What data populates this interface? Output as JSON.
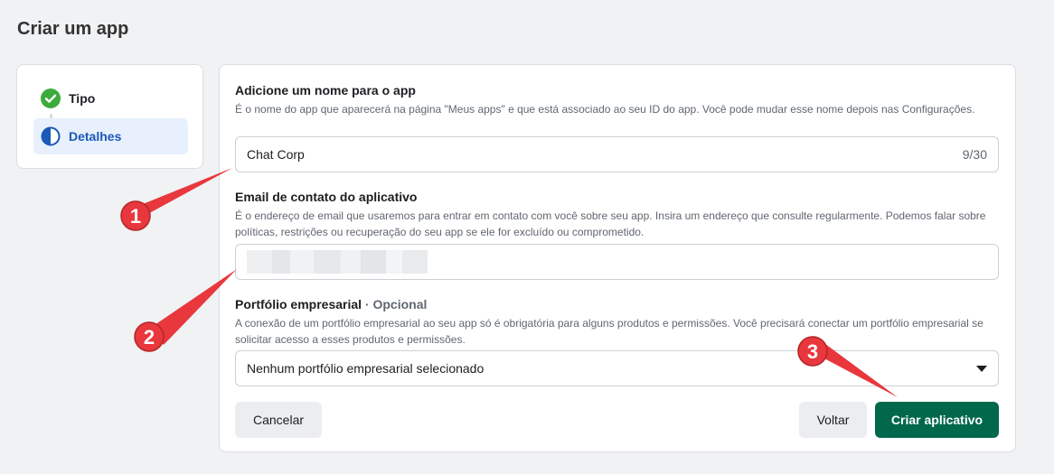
{
  "page": {
    "title": "Criar um app"
  },
  "steps": [
    {
      "label": "Tipo",
      "state": "done"
    },
    {
      "label": "Detalhes",
      "state": "active"
    }
  ],
  "form": {
    "name_section": {
      "title": "Adicione um nome para o app",
      "description": "É o nome do app que aparecerá na página \"Meus apps\" e que está associado ao seu ID do app. Você pode mudar esse nome depois nas Configurações.",
      "value": "Chat Corp",
      "counter": "9/30"
    },
    "email_section": {
      "title": "Email de contato do aplicativo",
      "description": "É o endereço de email que usaremos para entrar em contato com você sobre seu app. Insira um endereço que consulte regularmente. Podemos falar sobre políticas, restrições ou recuperação do seu app se ele for excluído ou comprometido."
    },
    "portfolio_section": {
      "title": "Portfólio empresarial",
      "optional_label": " · Opcional",
      "description": "A conexão de um portfólio empresarial ao seu app só é obrigatória para alguns produtos e permissões. Você precisará conectar um portfólio empresarial se solicitar acesso a esses produtos e permissões.",
      "selected": "Nenhum portfólio empresarial selecionado"
    }
  },
  "buttons": {
    "cancel": "Cancelar",
    "back": "Voltar",
    "create": "Criar aplicativo"
  },
  "annotations": [
    "1",
    "2",
    "3"
  ],
  "colors": {
    "accent_green": "#02684b",
    "active_blue": "#1b59b8",
    "annotation_red": "#e8383d"
  }
}
